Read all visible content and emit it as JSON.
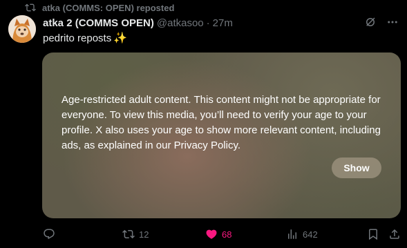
{
  "repost_banner": {
    "text": "atka (COMMS: OPEN) reposted",
    "icon": "repost-icon"
  },
  "author": {
    "display_name": "atka 2 (COMMS OPEN)",
    "handle": "@atkasoo",
    "separator": "·",
    "time": "27m"
  },
  "tweet": {
    "text": "pedrito reposts",
    "emoji": "✨"
  },
  "media": {
    "warning": "Age-restricted adult content. This content might not be appropriate for everyone. To view this media, you’ll need to verify your age to your profile. X also uses your age to show more relevant content, including ads, as explained in our Privacy Policy.",
    "show_label": "Show"
  },
  "actions": {
    "replies": "",
    "reposts": "12",
    "likes": "68",
    "views": "642"
  },
  "colors": {
    "accent_like": "#f91880",
    "muted": "#71767b",
    "text": "#e7e9ea",
    "background": "#000000"
  }
}
